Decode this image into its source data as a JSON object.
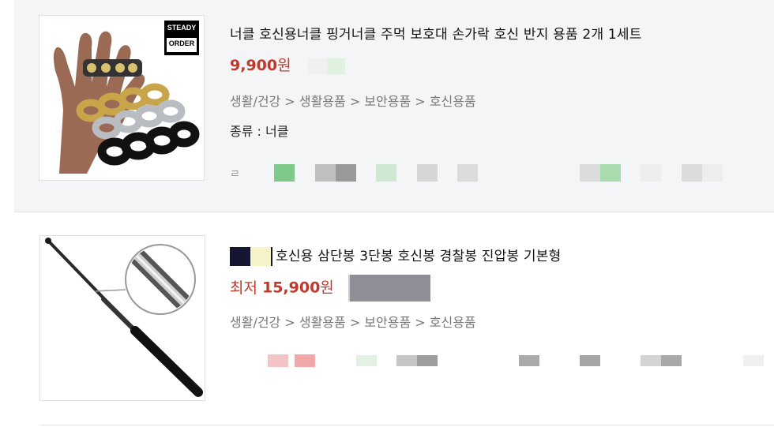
{
  "items": [
    {
      "title": "너클 호신용너클 핑거너클 주먹 보호대 손가락 호신 반지 용품 2개 1세트",
      "price": "9,900",
      "currency": "원",
      "category": "생활/건강 > 생활용품 > 보안용품 > 호신용품",
      "attribute": "종류 : 너클",
      "badge_line1": "STEADY",
      "badge_line2": "ORDER",
      "meta_char": "ㄹ"
    },
    {
      "title": "호신용 삼단봉 3단봉 호신봉 경찰봉 진압봉 기본형",
      "lowest_label": "최저",
      "price": "15,900",
      "currency": "원",
      "category": "생활/건강 > 생활용품 > 보안용품 > 호신용품"
    }
  ],
  "colors": {
    "price": "#c0392b",
    "selected_bg": "#f4f5f7",
    "category_text": "#777777"
  }
}
